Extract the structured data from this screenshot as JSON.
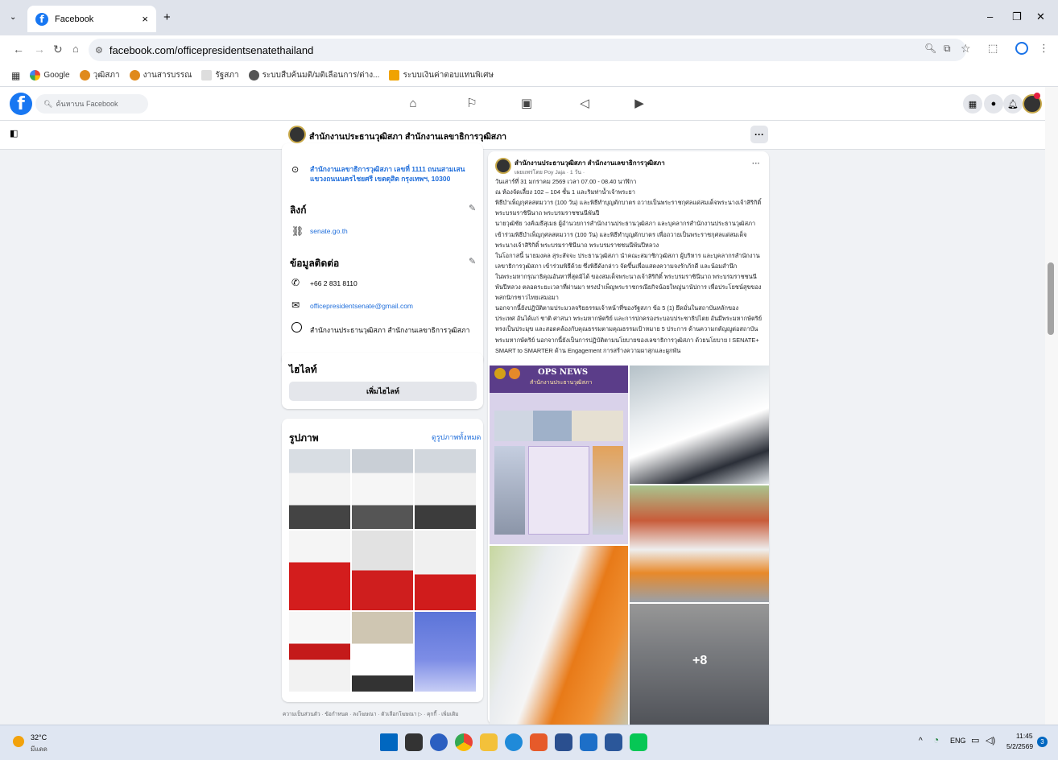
{
  "browser": {
    "tab_title": "Facebook",
    "tab_close": "×",
    "new_tab": "+",
    "url": "facebook.com/officepresidentsenatethailand",
    "bookmarks": [
      "Google",
      "วุฒิสภา",
      "งานสารบรรณ",
      "รัฐสภา",
      "ระบบสืบค้นมติ/มติเลือนการ/ต่าง...",
      "ระบบเงินค่าตอบแทนพิเศษ"
    ],
    "window_controls": [
      "–",
      "❐",
      "✕"
    ]
  },
  "facebook": {
    "search_placeholder": "ค้นหาบน Facebook"
  },
  "page": {
    "name": "สำนักงานประธานวุฒิสภา สำนักงานเลขาธิการวุฒิสภา",
    "more": "···"
  },
  "intro": {
    "address": "สำนักงานเลขาธิการวุฒิสภา เลขที่ 1111 ถนนสามเสน แขวงถนนนครไชยศรี เขตดุสิต กรุงเทพฯ, 10300",
    "links_header": "ลิงก์",
    "website": "senate.go.th",
    "contact_header": "ข้อมูลติดต่อ",
    "phone": "+66 2 831 8110",
    "email": "officepresidentsenate@gmail.com",
    "messenger": "สำนักงานประธานวุฒิสภา สำนักงานเลขาธิการวุฒิสภา"
  },
  "highlights": {
    "header": "ไฮไลท์",
    "add_button": "เพิ่มไฮไลท์"
  },
  "photos": {
    "header": "รูปภาพ",
    "see_all": "ดูรูปภาพทั้งหมด"
  },
  "footer": "ความเป็นส่วนตัว · ข้อกำหนด · ลงโฆษณา · ตัวเลือกโฆษณา ▷ · คุกกี้ · เพิ่มเติม",
  "post": {
    "author": "สำนักงานประธานวุฒิสภา สำนักงานเลขาธิการวุฒิสภา",
    "meta": "เผยแพร่โดย Poy Jaja · 1 วัน ·",
    "more": "···",
    "lines": [
      "วันเสาร์ที่ 31 มกราคม 2569 เวลา 07.00 - 08.40 นาฬิกา",
      "ณ ห้องจัดเลี้ยง 102 – 104 ชั้น 1 และริมท่าน้ำเจ้าพระยา",
      "พิธีบำเพ็ญกุศลสตมวาร (100 วัน) และพิธีทำบุญตักบาตร ถวายเป็นพระราชกุศลแด่สมเด็จพระนางเจ้าสิริกิติ์",
      "พระบรมราชินีนาถ พระบรมราชชนนีพันปี",
      "    นายวุฒิชัย วงศ์เมธีสุเมธ ผู้อำนวยการสำนักงานประธานวุฒิสภา และบุคลากรสำนักงานประธานวุฒิสภา",
      "เข้าร่วมพิธีบำเพ็ญกุศลสตมวาร (100 วัน) และพิธีทำบุญตักบาตร เพื่อถวายเป็นพระราชกุศลแด่สมเด็จ",
      "พระนางเจ้าสิริกิติ์ พระบรมราชินีนาถ พระบรมราชชนนีพันปีหลวง",
      "    ในโอกาสนี้ นายมงคล สุระสัจจะ ประธานวุฒิสภา นำคณะสมาชิกวุฒิสภา ผู้บริหาร และบุคลากรสำนักงาน",
      "เลขาธิการวุฒิสภา เข้าร่วมพิธีด้วย ซึ่งพิธีดังกล่าว จัดขึ้นเพื่อแสดงความจงรักภักดี และน้อมสำนึก",
      "ในพระมหากรุณาธิคุณอันหาที่สุดมิได้ ของสมเด็จพระนางเจ้าสิริกิติ์ พระบรมราชินีนาถ พระบรมราชชนนี",
      "พันปีหลวง ตลอดระยะเวลาที่ผ่านมา ทรงบำเพ็ญพระราชกรณียกิจน้อยใหญ่นานัปการ เพื่อประโยชน์สุขของ",
      "พสกนิกรชาวไทยเสมอมา",
      "    นอกจากนี้ยังปฏิบัติตามประมวลจริยธรรมเจ้าหน้าที่ของรัฐสภา ข้อ 5 (1) ยึดมั่นในสถาบันหลักของ",
      "ประเทศ อันได้แก่ ชาติ ศาสนา พระมหากษัตริย์ และการปกครองระบอบประชาธิปไตย อันมีพระมหากษัตริย์",
      "ทรงเป็นประมุข และสอดคล้องกับคุณธรรมตามคุณธรรมเป้าหมาย 5 ประการ ด้านความกตัญญูต่อสถาบัน",
      "พระมหากษัตริย์ นอกจากนี้ยังเป็นการปฏิบัติตามนโยบายของเลขาธิการวุฒิสภา ด้วยนโยบาย I SENATE+",
      "SMART to SMARTER ด้าน Engagement การสร้างความผาสุกและผูกพัน"
    ],
    "news_title": "OPS NEWS",
    "news_subtitle": "สำนักงานประธานวุฒิสภา",
    "more_photos": "+8"
  },
  "taskbar": {
    "temp": "32°C",
    "weather": "มีแดด",
    "lang": "ENG",
    "time": "11:45",
    "date": "5/2/2569",
    "notif": "3"
  }
}
